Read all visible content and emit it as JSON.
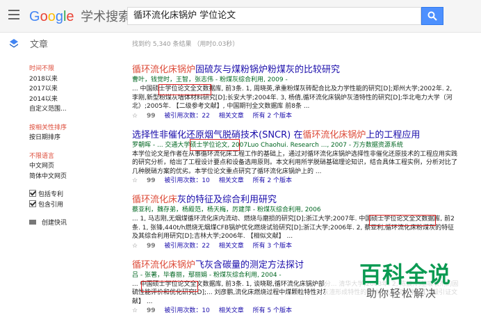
{
  "header": {
    "logo_text": "Google",
    "logo_suffix": "学术搜索",
    "search_value": "循环流化床锅炉 学位论文"
  },
  "subbar": {
    "section_label": "文章",
    "result_stats": "找到约 5,340 条结果 （用时0.03秒）"
  },
  "sidebar": {
    "time_items": [
      "时间不限",
      "2018以来",
      "2017以来",
      "2014以来",
      "自定义范围..."
    ],
    "sort_items": [
      "按相关性排序",
      "按日期排序"
    ],
    "lang_items": [
      "不限语言",
      "中文网页",
      "简体中文网页"
    ],
    "checkbox_patents": "包括专利",
    "checkbox_citations": "包含引用",
    "create_alert": "创建快讯"
  },
  "results": [
    {
      "title_pre": "",
      "title_hl": "循环流化床锅炉",
      "title_post": "固硫灰与煤粉锅炉粉煤灰的比较研究",
      "authors": "曹叶，钱觉时，王智，张志伟 - 粉煤灰综合利用, 2009 -",
      "snippet": "... 中国硕士学位论文全文数据库, 前3条. 1, 周晓英,承重粉煤灰砖配合比及力学性能的研究[D];郑州大学;2002年. 2, 李刚,新型粉煤灰墙体材料研究[D];长安大学;2004年. 3, 杨倩,循环流化床锅炉灰渣特性的研究[D];华北电力大学（河北）;2005年. 【二级参考文献】, 中国期刊全文数据库 前8条 ...",
      "cited": "被引用次数：22",
      "related": "相关文章",
      "versions": "所有 2 个版本"
    },
    {
      "title_pre": "选择性非催化还原烟气脱硝技术(SNCR) 在",
      "title_hl": "循环流化床锅炉",
      "title_post": "上的工程应用",
      "authors": "罗朝晖 - ... 交通大学硕士学位论文, 2007Luo Chaohui. Research ..., 2007 - 万方数据资源系统",
      "snippet": "本学位论文是作者在从事循环流化床工程工作的基础上，通过对循环流化床锅炉选择性非催化还原技术的工程应用实践的研究分析，给出了工程设计要点和设备选用原则。本文利用所学脱硝基础理论知识，结合具体工程实例，分析对比了几种脱硝方案的优劣。本学位论文重点研究了循环流化床锅炉上的 ...",
      "cited": "被引用次数：10",
      "related": "相关文章",
      "versions": "所有 2 个版本"
    },
    {
      "title_pre": "",
      "title_hl": "循环流化床",
      "title_post": "灰的特征及综合利用研究",
      "authors": "蔡亚利，魏存弟，杨殿范，杨天梅，厉建萍 - 粉煤灰综合利用, 2006",
      "snippet": "... 1, 马志刚,无烟煤循环流化床内流动、燃烧与磨损的研究[D];浙江大学;2007年. 中国硕士学位论文全文数据库, 前2条. 1, 张锋,440t/h燃烧无烟煤CFB锅炉优化燃烧试验研究[D];浙江大学;2006年. 2, 蔡亚利,循环流化床粉煤灰的特征及其综合利用研究[D];吉林大学;2006年. 【相似文献】 ...",
      "cited": "被引用次数：22",
      "related": "相关文章",
      "versions": "所有 3 个版本"
    },
    {
      "title_pre": "",
      "title_hl": "循环流化床锅炉",
      "title_post": "飞灰含碳量的测定方法探讨",
      "authors": "吕 - 张著，毕春丽，鄢丽娟 - 粉煤灰综合利用, 2004 -",
      "snippet": "... 中国硕士学位论文全文数据库, 前3条. 1, 谈晓聪,循环流化床锅炉部分... 清华大学;2003年. 2, 陈波,钙基吸收剂的固硫性能评价和优化研究[D];... 刘彦鹏,流化床燃烧过程中煤颗粒特性对灰渣形成特性的影响[D];浙江大学; 【一般引证文献】 ...",
      "cited": "被引用次数：10",
      "related": "相关文章",
      "versions": "所有 5 个版本"
    }
  ],
  "watermark": {
    "main": "百科全说",
    "sub": "助你轻松解决"
  },
  "colors": {
    "link": "#1a0dab",
    "highlight": "#dd4b39",
    "author_green": "#006621",
    "search_blue": "#4d90fe",
    "annotation_red": "#e02020",
    "watermark_green": "#0a9a52"
  }
}
